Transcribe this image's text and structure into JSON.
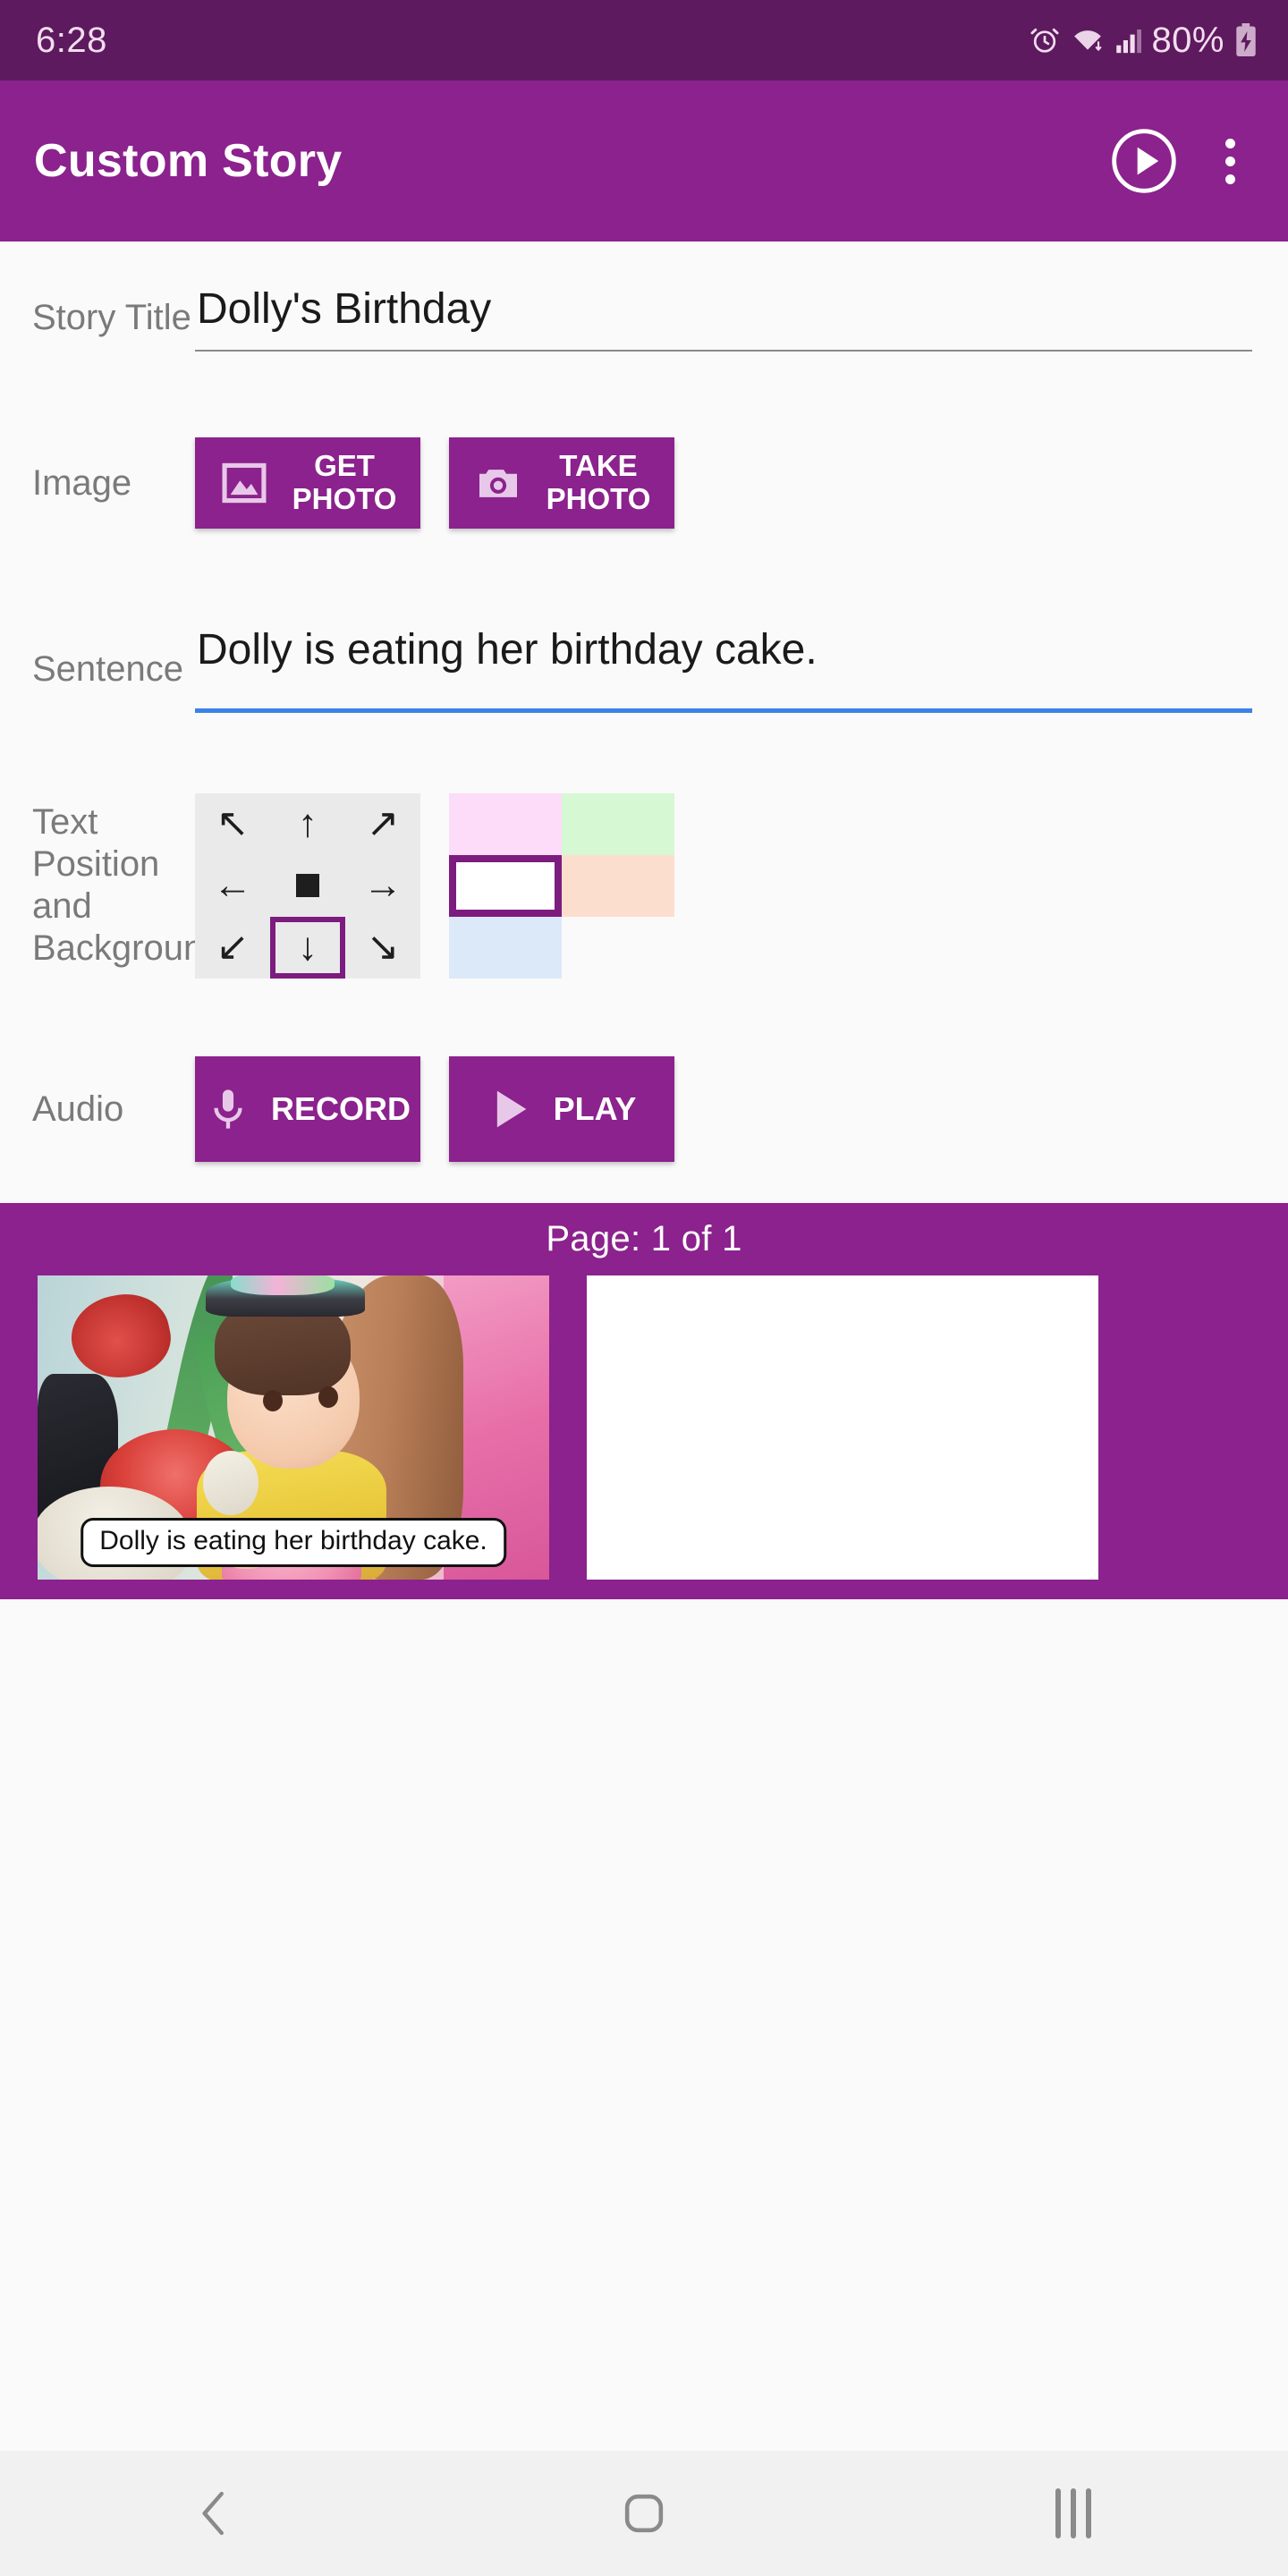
{
  "status_bar": {
    "time": "6:28",
    "battery_percent": "80%",
    "icons": [
      "alarm-icon",
      "wifi-icon",
      "signal-icon",
      "battery-charging-icon"
    ]
  },
  "app_bar": {
    "title": "Custom Story",
    "play_icon": "play-circle-icon",
    "overflow_icon": "more-vertical-icon"
  },
  "form": {
    "story_title": {
      "label": "Story Title",
      "value": "Dolly's Birthday",
      "placeholder": "Story Title"
    },
    "image": {
      "label": "Image",
      "get_photo_label": "GET\nPHOTO",
      "get_photo_line1": "GET",
      "get_photo_line2": "PHOTO",
      "get_photo_icon": "image-icon",
      "take_photo_line1": "TAKE",
      "take_photo_line2": "PHOTO",
      "take_photo_icon": "camera-icon"
    },
    "sentence": {
      "label": "Sentence",
      "value": "Dolly is eating her birthday cake.",
      "placeholder": "Sentence",
      "focused_underline_color": "#3B82E8"
    },
    "text_position_background": {
      "label": "Text Position and Background",
      "position_options": [
        {
          "name": "top-left",
          "glyph": "↖",
          "selected": false
        },
        {
          "name": "top-center",
          "glyph": "↑",
          "selected": false
        },
        {
          "name": "top-right",
          "glyph": "↗",
          "selected": false
        },
        {
          "name": "middle-left",
          "glyph": "←",
          "selected": false
        },
        {
          "name": "center",
          "glyph": "square",
          "selected": false
        },
        {
          "name": "middle-right",
          "glyph": "→",
          "selected": false
        },
        {
          "name": "bottom-left",
          "glyph": "↙",
          "selected": false
        },
        {
          "name": "bottom-center",
          "glyph": "↓",
          "selected": true
        },
        {
          "name": "bottom-right",
          "glyph": "↘",
          "selected": false
        }
      ],
      "background_colors": [
        {
          "name": "pink",
          "hex": "#FCDCF8",
          "selected": false
        },
        {
          "name": "green",
          "hex": "#D6F8D2",
          "selected": false
        },
        {
          "name": "white",
          "hex": "#FFFFFF",
          "selected": true
        },
        {
          "name": "peach",
          "hex": "#FCDECF",
          "selected": false
        },
        {
          "name": "blue",
          "hex": "#DCE9F8",
          "selected": false
        },
        {
          "name": "none",
          "hex": "#FAFAFA",
          "selected": false
        }
      ],
      "selection_color": "#7B1C7E"
    },
    "audio": {
      "label": "Audio",
      "record_label": "RECORD",
      "record_icon": "microphone-icon",
      "play_label": "PLAY",
      "play_icon": "play-triangle-icon"
    }
  },
  "pages_strip": {
    "counter": "Page: 1 of 1",
    "pages": [
      {
        "name": "page-1",
        "caption": "Dolly is eating her birthday cake.",
        "has_photo": true
      },
      {
        "name": "page-blank",
        "caption": "",
        "has_photo": false
      }
    ]
  },
  "nav_bar": {
    "back_icon": "back-chevron-icon",
    "home_icon": "home-icon",
    "recents_icon": "recents-icon"
  },
  "theme": {
    "primary": "#8B228D",
    "status_bar": "#5E1A5E",
    "background": "#FAFAFA",
    "accent": "#3B82E8"
  }
}
